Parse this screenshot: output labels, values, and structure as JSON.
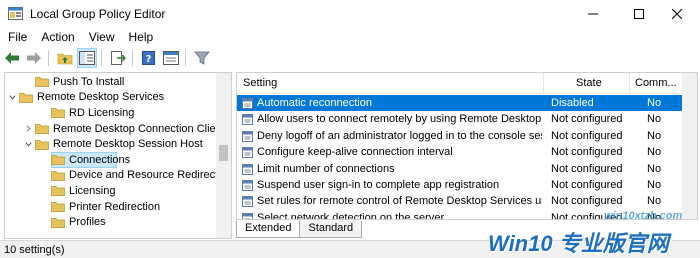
{
  "window": {
    "title": "Local Group Policy Editor",
    "icons": [
      "app-icon",
      "minimize-icon",
      "maximize-icon",
      "close-icon"
    ]
  },
  "menu": [
    {
      "label": "File"
    },
    {
      "label": "Action"
    },
    {
      "label": "View"
    },
    {
      "label": "Help"
    }
  ],
  "toolbar": {
    "buttons": [
      "back-icon",
      "forward-icon",
      "up-folder-icon",
      "show-hide-tree-icon",
      "export-list-icon",
      "help-icon",
      "properties-icon",
      "filter-icon"
    ]
  },
  "tree": {
    "items": [
      {
        "label": "Push To Install",
        "level": 1,
        "expander": "none"
      },
      {
        "label": "Remote Desktop Services",
        "level": 0,
        "expander": "expanded"
      },
      {
        "label": "RD Licensing",
        "level": 2,
        "expander": "none"
      },
      {
        "label": "Remote Desktop Connection Client",
        "level": 1,
        "expander": "collapsed"
      },
      {
        "label": "Remote Desktop Session Host",
        "level": 1,
        "expander": "expanded"
      },
      {
        "label": "Connections",
        "level": 2,
        "expander": "none",
        "selected": true
      },
      {
        "label": "Device and Resource Redirection",
        "level": 2,
        "expander": "none"
      },
      {
        "label": "Licensing",
        "level": 2,
        "expander": "none"
      },
      {
        "label": "Printer Redirection",
        "level": 2,
        "expander": "none"
      },
      {
        "label": "Profiles",
        "level": 2,
        "expander": "none"
      }
    ]
  },
  "list": {
    "columns": [
      "Setting",
      "State",
      "Comm..."
    ],
    "rows": [
      {
        "setting": "Automatic reconnection",
        "state": "Disabled",
        "comment": "No",
        "selected": true
      },
      {
        "setting": "Allow users to connect remotely by using Remote Desktop S...",
        "state": "Not configured",
        "comment": "No"
      },
      {
        "setting": "Deny logoff of an administrator logged in to the console sess...",
        "state": "Not configured",
        "comment": "No"
      },
      {
        "setting": "Configure keep-alive connection interval",
        "state": "Not configured",
        "comment": "No"
      },
      {
        "setting": "Limit number of connections",
        "state": "Not configured",
        "comment": "No"
      },
      {
        "setting": "Suspend user sign-in to complete app registration",
        "state": "Not configured",
        "comment": "No"
      },
      {
        "setting": "Set rules for remote control of Remote Desktop Services user ...",
        "state": "Not configured",
        "comment": "No"
      },
      {
        "setting": "Select network detection on the server",
        "state": "Not configured",
        "comment": "No"
      }
    ]
  },
  "tabs": [
    {
      "label": "Extended",
      "active": true
    },
    {
      "label": "Standard",
      "active": false
    }
  ],
  "status": {
    "text": "10 setting(s)"
  },
  "watermark": {
    "url": "win10xtzb.com",
    "text": "Win10 专业版官网"
  },
  "colors": {
    "selection": "#0078d7",
    "tree_selection": "#cce8ff",
    "folder": "#e8c25a"
  }
}
